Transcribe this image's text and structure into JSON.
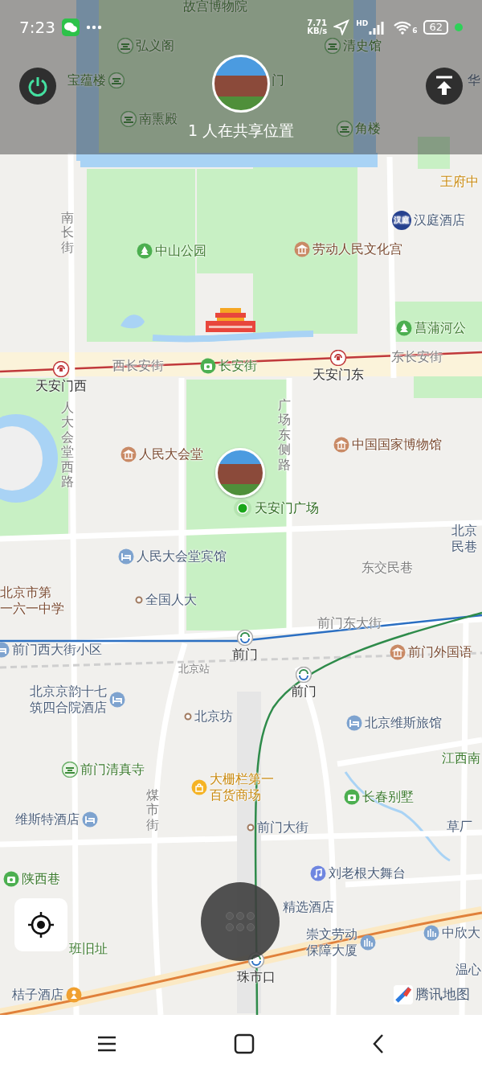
{
  "status_bar": {
    "time": "7:23",
    "speed_value": "7.71",
    "speed_unit": "KB/s",
    "network_label": "HD",
    "wifi_label": "6",
    "battery": "62"
  },
  "header": {
    "sharing_text": "1 人在共享位置"
  },
  "map": {
    "labels": [
      {
        "text": "故宫博物院",
        "kind": "area-green"
      },
      {
        "text": "弘义阁",
        "kind": "palace"
      },
      {
        "text": "清史馆",
        "kind": "palace"
      },
      {
        "text": "宝蕴楼",
        "kind": "palace"
      },
      {
        "text": "门",
        "kind": "area-green"
      },
      {
        "text": "华",
        "kind": "area"
      },
      {
        "text": "南熏殿",
        "kind": "palace"
      },
      {
        "text": "角楼",
        "kind": "palace"
      },
      {
        "text": "王府中",
        "kind": "shop-text"
      },
      {
        "text": "南长街",
        "kind": "road-vertical"
      },
      {
        "text": "汉庭酒店",
        "kind": "brand",
        "badge": "汉庭"
      },
      {
        "text": "中山公园",
        "kind": "park"
      },
      {
        "text": "劳动人民文化宫",
        "kind": "culture"
      },
      {
        "text": "菖蒲河公",
        "kind": "park"
      },
      {
        "text": "西长安街",
        "kind": "road"
      },
      {
        "text": "长安街",
        "kind": "camera"
      },
      {
        "text": "东长安街",
        "kind": "road"
      },
      {
        "text": "天安门西",
        "kind": "station-red"
      },
      {
        "text": "天安门东",
        "kind": "station-red"
      },
      {
        "text": "人大会堂西路",
        "kind": "road-vertical"
      },
      {
        "text": "广场东侧路",
        "kind": "road-vertical"
      },
      {
        "text": "人民大会堂",
        "kind": "culture"
      },
      {
        "text": "中国国家博物馆",
        "kind": "culture"
      },
      {
        "text": "天安门广场",
        "kind": "location"
      },
      {
        "lines": [
          "北京",
          "民巷"
        ],
        "kind": "area"
      },
      {
        "text": "人民大会堂宾馆",
        "kind": "hotel"
      },
      {
        "text": "东交民巷",
        "kind": "road"
      },
      {
        "lines": [
          "北京市第",
          "一六一中学"
        ],
        "kind": "culture-text"
      },
      {
        "text": "全国人大",
        "kind": "dot"
      },
      {
        "text": "前门东大街",
        "kind": "road"
      },
      {
        "text": "前门西大街小区",
        "kind": "hotel"
      },
      {
        "text": "前门",
        "kind": "station-blue"
      },
      {
        "text": "北京站",
        "kind": "road-small"
      },
      {
        "text": "前门外国语",
        "kind": "culture"
      },
      {
        "text": "前门",
        "kind": "station-blue"
      },
      {
        "lines": [
          "北京京韵十七",
          "筑四合院酒店"
        ],
        "kind": "hotel"
      },
      {
        "text": "北京坊",
        "kind": "dot"
      },
      {
        "text": "北京维斯旅馆",
        "kind": "hotel"
      },
      {
        "text": "江西南",
        "kind": "area-green"
      },
      {
        "text": "前门清真寺",
        "kind": "palace"
      },
      {
        "lines": [
          "大栅栏第一",
          "百货商场"
        ],
        "kind": "shop"
      },
      {
        "text": "煤市街",
        "kind": "road-vertical"
      },
      {
        "text": "长春别墅",
        "kind": "camera"
      },
      {
        "text": "维斯特酒店",
        "kind": "hotel"
      },
      {
        "text": "前门大街",
        "kind": "dot"
      },
      {
        "text": "草厂",
        "kind": "area"
      },
      {
        "text": "陕西巷",
        "kind": "camera"
      },
      {
        "text": "刘老根大舞台",
        "kind": "music"
      },
      {
        "text": "精选酒店",
        "kind": "area"
      },
      {
        "lines": [
          "崇文劳动",
          "保障大厦"
        ],
        "kind": "office"
      },
      {
        "text": "中欣大",
        "kind": "office"
      },
      {
        "text": "班旧址",
        "kind": "area-green"
      },
      {
        "text": "珠市口",
        "kind": "station-blue"
      },
      {
        "text": "温心",
        "kind": "area"
      },
      {
        "text": "桔子酒店",
        "kind": "child"
      }
    ],
    "logo": "腾讯地图"
  }
}
